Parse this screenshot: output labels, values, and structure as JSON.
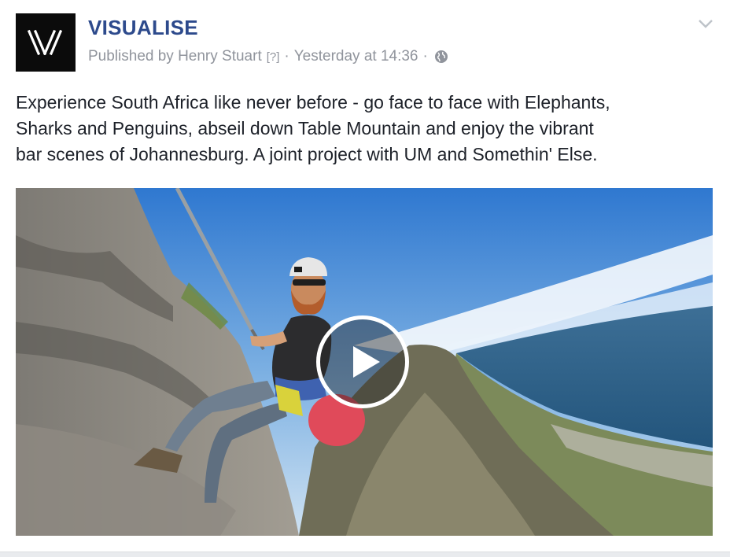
{
  "post": {
    "page_name": "VISUALISE",
    "published_by": "Published by Henry Stuart",
    "help_marker": "[?]",
    "separator": "·",
    "timestamp": "Yesterday at 14:36",
    "audience_icon": "globe-icon",
    "menu_icon": "chevron-down-icon",
    "text_lines": [
      "Experience South Africa like never before - go face to face with Elephants,",
      "Sharks and Penguins, abseil down Table Mountain and enjoy the vibrant",
      "bar scenes of Johannesburg. A joint project with UM and Somethin' Else."
    ],
    "video": {
      "play_icon": "play-icon"
    }
  },
  "colors": {
    "page_name": "#2d4a8c",
    "meta_text": "#90949c",
    "body_text": "#1d2129",
    "avatar_bg": "#0b0b0b"
  }
}
